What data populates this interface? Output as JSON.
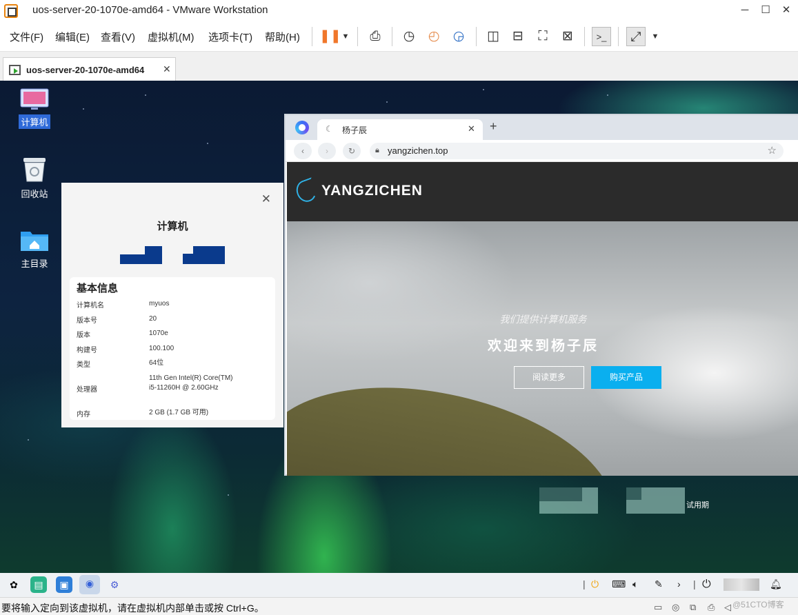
{
  "window": {
    "title": "uos-server-20-1070e-amd64 - VMware Workstation"
  },
  "menu": {
    "items": [
      "文件(F)",
      "编辑(E)",
      "查看(V)",
      "虚拟机(M)",
      "选项卡(T)",
      "帮助(H)"
    ]
  },
  "tab": {
    "label": "uos-server-20-1070e-amd64"
  },
  "desktop": {
    "icons": [
      {
        "label": "计算机"
      },
      {
        "label": "回收站"
      },
      {
        "label": "主目录"
      }
    ],
    "trial_label": "试用期"
  },
  "info_panel": {
    "title": "计算机",
    "section_title": "基本信息",
    "rows": [
      {
        "key": "计算机名",
        "value": "myuos"
      },
      {
        "key": "版本号",
        "value": "20"
      },
      {
        "key": "版本",
        "value": "1070e"
      },
      {
        "key": "构建号",
        "value": "100.100"
      },
      {
        "key": "类型",
        "value": "64位"
      },
      {
        "key": "处理器",
        "value": "11th Gen Intel(R) Core(TM)",
        "value2": "i5-11260H @ 2.60GHz"
      },
      {
        "key": "内存",
        "value": "2 GB (1.7 GB 可用)"
      }
    ]
  },
  "browser": {
    "tab_title": "杨子辰",
    "url": "yangzichen.top",
    "site": {
      "brand": "YANGZICHEN",
      "subtitle": "我们提供计算机服务",
      "headline": "欢迎来到杨子辰",
      "button_more": "阅读更多",
      "button_buy": "购买产品"
    }
  },
  "statusbar": {
    "message": "要将输入定向到该虚拟机，请在虚拟机内部单击或按 Ctrl+G。"
  },
  "watermark": "@51CTO博客",
  "colors": {
    "accent": "#2f6ad8",
    "buy_button": "#0aafef",
    "pause": "#f0772b"
  }
}
